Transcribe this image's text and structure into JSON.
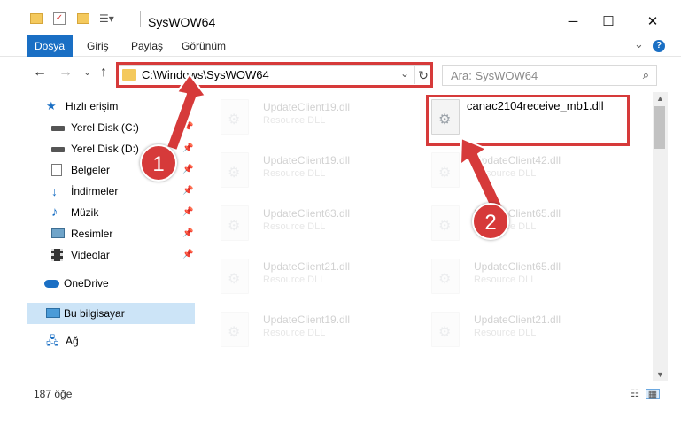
{
  "window": {
    "title": "SysWOW64",
    "minimize_glyph": "─",
    "maximize_glyph": "☐",
    "close_glyph": "✕"
  },
  "ribbon": {
    "tabs": [
      "Dosya",
      "Giriş",
      "Paylaş",
      "Görünüm"
    ],
    "expand_glyph": "⌄",
    "help_glyph": "?"
  },
  "address": {
    "path": "C:\\Windows\\SysWOW64",
    "dropdown_glyph": "⌄",
    "refresh_glyph": "↻"
  },
  "search": {
    "placeholder": "Ara: SysWOW64",
    "icon": "search-icon"
  },
  "nav": {
    "back_glyph": "←",
    "forward_glyph": "→",
    "recent_glyph": "⌄",
    "up_glyph": "↑"
  },
  "sidebar": {
    "items": [
      {
        "label": "Hızlı erişim",
        "icon": "star-icon"
      },
      {
        "label": "Yerel Disk (C:)",
        "icon": "drive-icon",
        "pinned": true
      },
      {
        "label": "Yerel Disk (D:)",
        "icon": "drive-icon",
        "pinned": true
      },
      {
        "label": "Belgeler",
        "icon": "documents-icon",
        "pinned": true
      },
      {
        "label": "İndirmeler",
        "icon": "download-icon",
        "pinned": true
      },
      {
        "label": "Müzik",
        "icon": "music-icon",
        "pinned": true
      },
      {
        "label": "Resimler",
        "icon": "pictures-icon",
        "pinned": true
      },
      {
        "label": "Videolar",
        "icon": "videos-icon",
        "pinned": true
      },
      {
        "label": "OneDrive",
        "icon": "cloud-icon"
      },
      {
        "label": "Bu bilgisayar",
        "icon": "computer-icon",
        "selected": true
      },
      {
        "label": "Ağ",
        "icon": "network-icon"
      }
    ]
  },
  "files": {
    "highlighted": {
      "name": "canac2104receive_mb1.dll",
      "type": ""
    },
    "left_column": [
      {
        "name": "UpdateClient19.dll",
        "type": "Resource DLL"
      },
      {
        "name": "UpdateClient19.dll",
        "type": "Resource DLL"
      },
      {
        "name": "UpdateClient63.dll",
        "type": "Resource DLL"
      },
      {
        "name": "UpdateClient21.dll",
        "type": "Resource DLL"
      },
      {
        "name": "UpdateClient19.dll",
        "type": "Resource DLL"
      }
    ],
    "right_column": [
      {
        "name": "UpdateClient42.dll",
        "type": "Resource DLL"
      },
      {
        "name": "UpdateClient65.dll",
        "type": "Resource DLL"
      },
      {
        "name": "UpdateClient65.dll",
        "type": "Resource DLL"
      },
      {
        "name": "UpdateClient21.dll",
        "type": "Resource DLL"
      }
    ]
  },
  "status": {
    "count": "187 öğe"
  },
  "annotations": {
    "badge1": "1",
    "badge2": "2",
    "color": "#d63a3a"
  }
}
